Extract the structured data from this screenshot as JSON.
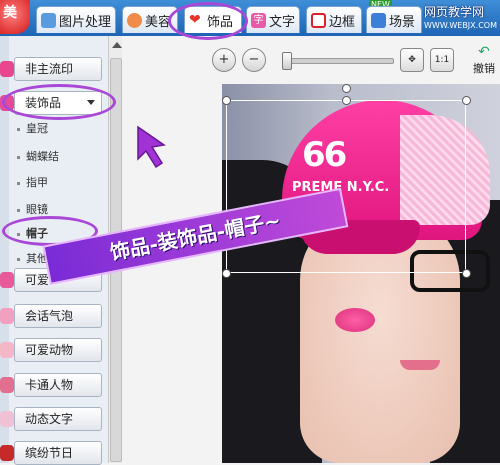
{
  "app": {
    "logo_text": "美"
  },
  "tabs": [
    {
      "label": "图片处理"
    },
    {
      "label": "美容"
    },
    {
      "label": "饰品"
    },
    {
      "label": "文字"
    },
    {
      "label": "边框"
    },
    {
      "label": "场景"
    }
  ],
  "tab_badge": "NEW",
  "watermark": {
    "line1": "网页教学网",
    "line2": "WWW.WEBJX.COM"
  },
  "sidebar": {
    "categories": [
      {
        "label": "非主流印"
      },
      {
        "label": "装饰品"
      },
      {
        "label": "可爱"
      },
      {
        "label": "会话气泡"
      },
      {
        "label": "可爱动物"
      },
      {
        "label": "卡通人物"
      },
      {
        "label": "动态文字"
      },
      {
        "label": "缤纷节日"
      }
    ],
    "subitems": [
      {
        "label": "皇冠"
      },
      {
        "label": "蝴蝶结"
      },
      {
        "label": "指甲"
      },
      {
        "label": "眼镜"
      },
      {
        "label": "帽子"
      },
      {
        "label": "其他"
      }
    ]
  },
  "toolbar": {
    "zoom_in": "+",
    "zoom_out": "−",
    "fit": "✥",
    "actual": "1:1",
    "undo_label": "撤销"
  },
  "canvas": {
    "cap_number": "66",
    "cap_text": "PREME N.Y.C."
  },
  "annotation": {
    "banner_text": "饰品-装饰品-帽子~"
  },
  "colors": {
    "accent": "#a948d6",
    "tab_bar": "#2a72c4"
  }
}
